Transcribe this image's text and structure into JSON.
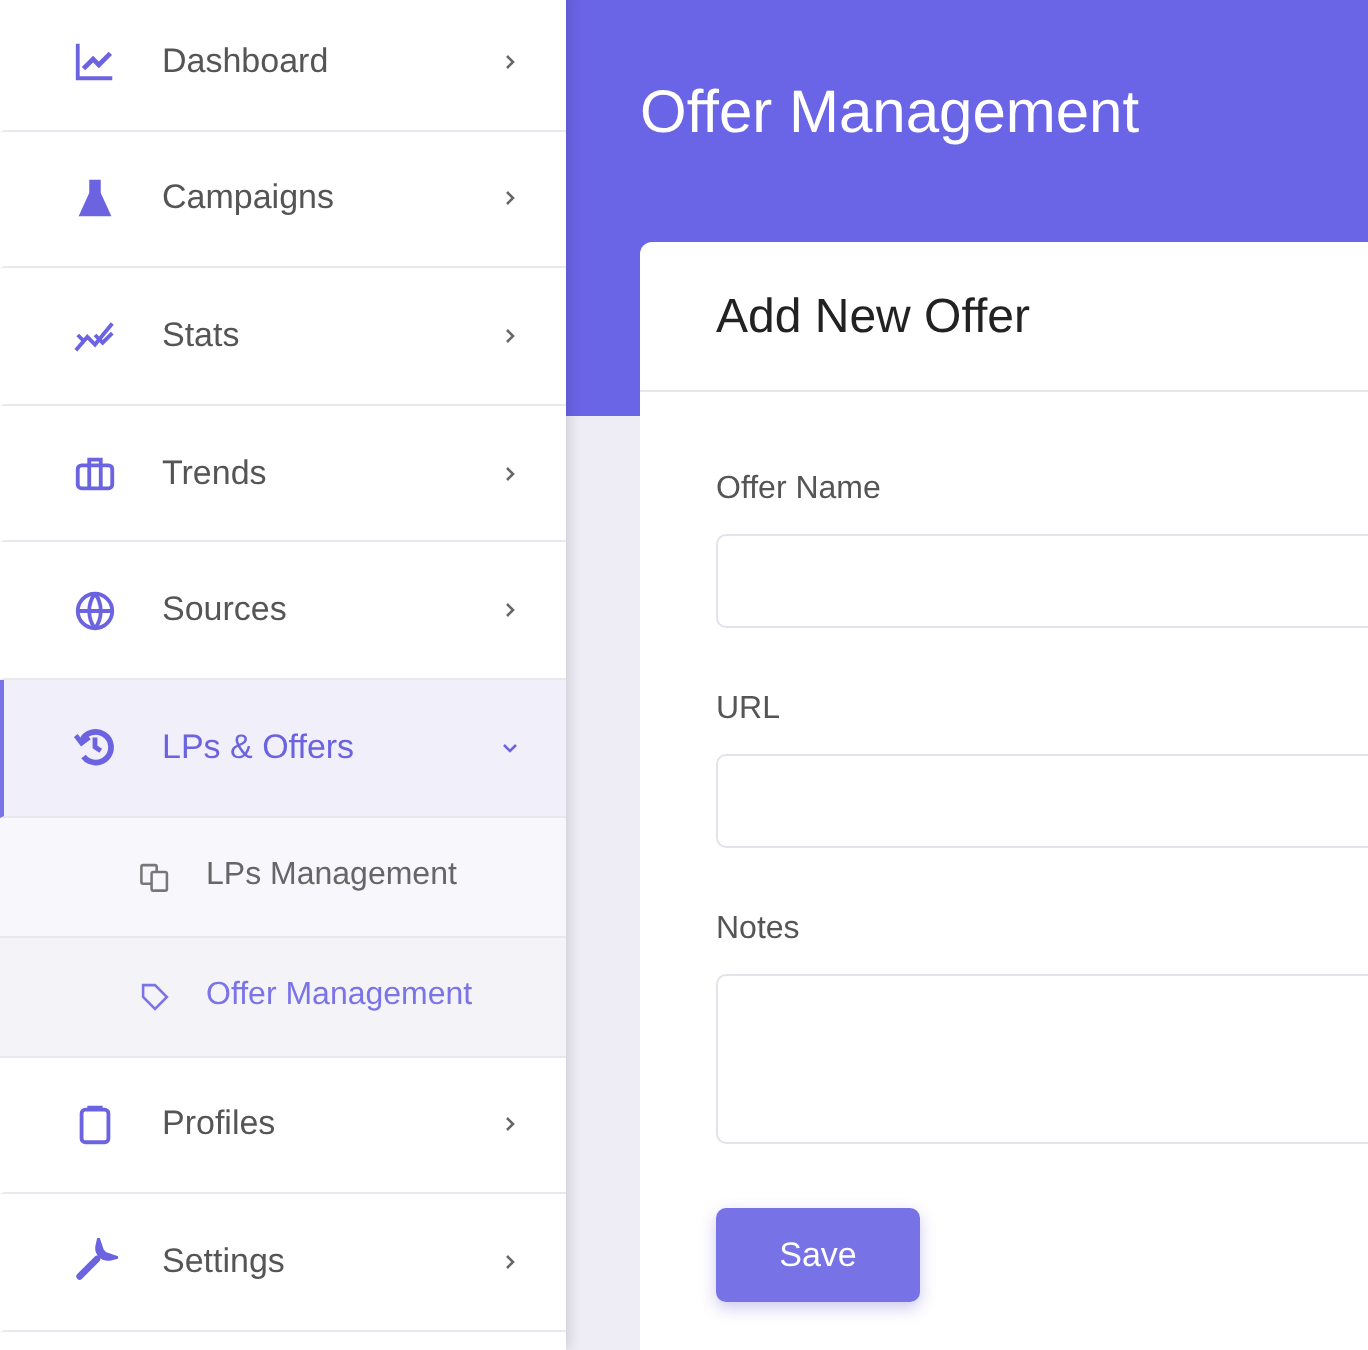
{
  "sidebar": {
    "items": [
      {
        "label": "Dashboard",
        "selected": false,
        "expanded": false
      },
      {
        "label": "Campaigns",
        "selected": false,
        "expanded": false
      },
      {
        "label": "Stats",
        "selected": false,
        "expanded": false
      },
      {
        "label": "Trends",
        "selected": false,
        "expanded": false
      },
      {
        "label": "Sources",
        "selected": false,
        "expanded": false
      },
      {
        "label": "LPs & Offers",
        "selected": true,
        "expanded": true,
        "children": [
          {
            "label": "LPs Management",
            "selected": false
          },
          {
            "label": "Offer Management",
            "selected": true
          }
        ]
      },
      {
        "label": "Profiles",
        "selected": false,
        "expanded": false
      },
      {
        "label": "Settings",
        "selected": false,
        "expanded": false
      }
    ]
  },
  "page": {
    "title": "Offer Management"
  },
  "card": {
    "title": "Add New Offer",
    "fields": [
      {
        "label": "Offer Name",
        "kind": "input"
      },
      {
        "label": "URL",
        "kind": "input"
      },
      {
        "label": "Notes",
        "kind": "textarea"
      }
    ],
    "button": "Save"
  }
}
